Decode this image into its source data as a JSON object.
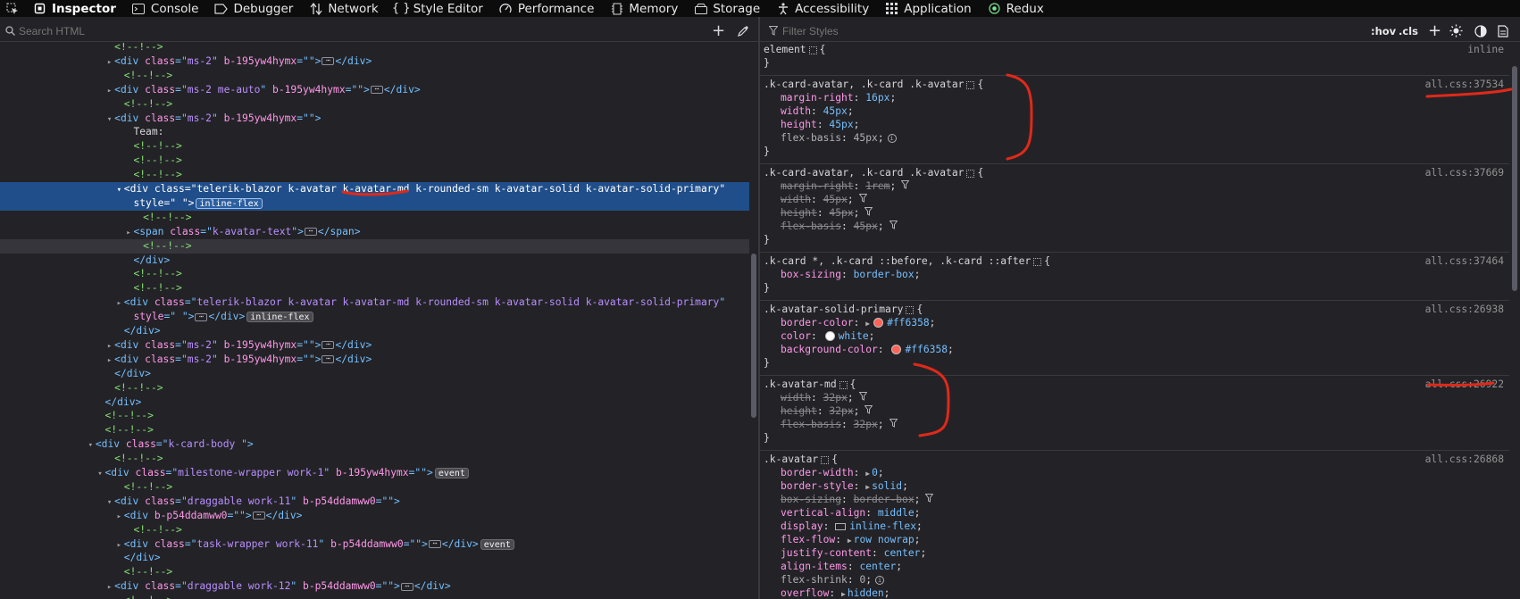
{
  "tabs": [
    {
      "label": "Inspector",
      "icon": "inspector-icon",
      "selected": true
    },
    {
      "label": "Console",
      "icon": "console-icon"
    },
    {
      "label": "Debugger",
      "icon": "debugger-icon"
    },
    {
      "label": "Network",
      "icon": "network-icon"
    },
    {
      "label": "Style Editor",
      "icon": "style-editor-icon"
    },
    {
      "label": "Performance",
      "icon": "performance-icon"
    },
    {
      "label": "Memory",
      "icon": "memory-icon"
    },
    {
      "label": "Storage",
      "icon": "storage-icon"
    },
    {
      "label": "Accessibility",
      "icon": "accessibility-icon"
    },
    {
      "label": "Application",
      "icon": "application-icon"
    },
    {
      "label": "Redux",
      "icon": "redux-icon"
    }
  ],
  "search": {
    "placeholder": "Search HTML",
    "add": "+"
  },
  "filter": {
    "placeholder": "Filter Styles",
    "hov": ":hov",
    "cls": ".cls",
    "add": "+"
  },
  "markup": [
    {
      "d": 11,
      "t": "",
      "s": [
        [
          "cm",
          "<!--!-->"
        ]
      ]
    },
    {
      "d": 11,
      "t": "c",
      "s": [
        [
          "tag",
          "<div "
        ],
        [
          "an",
          "class"
        ],
        [
          "tag",
          "=\""
        ],
        [
          "av",
          "ms-2"
        ],
        [
          "tag",
          "\" "
        ],
        [
          "an",
          "b-195yw4hymx"
        ],
        [
          "tag",
          "=\"\">"
        ],
        [
          "E",
          ""
        ],
        [
          "tag",
          "</div>"
        ]
      ]
    },
    {
      "d": 12,
      "t": "",
      "s": [
        [
          "cm",
          "<!--!-->"
        ]
      ]
    },
    {
      "d": 11,
      "t": "c",
      "s": [
        [
          "tag",
          "<div "
        ],
        [
          "an",
          "class"
        ],
        [
          "tag",
          "=\""
        ],
        [
          "av",
          "ms-2 me-auto"
        ],
        [
          "tag",
          "\" "
        ],
        [
          "an",
          "b-195yw4hymx"
        ],
        [
          "tag",
          "=\"\">"
        ],
        [
          "E",
          ""
        ],
        [
          "tag",
          "</div>"
        ]
      ]
    },
    {
      "d": 12,
      "t": "",
      "s": [
        [
          "cm",
          "<!--!-->"
        ]
      ]
    },
    {
      "d": 11,
      "t": "o",
      "s": [
        [
          "tag",
          "<div "
        ],
        [
          "an",
          "class"
        ],
        [
          "tag",
          "=\""
        ],
        [
          "av",
          "ms-2"
        ],
        [
          "tag",
          "\" "
        ],
        [
          "an",
          "b-195yw4hymx"
        ],
        [
          "tag",
          "=\"\">"
        ]
      ]
    },
    {
      "d": 13,
      "t": "",
      "s": [
        [
          "tx",
          "Team:"
        ]
      ]
    },
    {
      "d": 13,
      "t": "",
      "s": [
        [
          "cm",
          "<!--!-->"
        ]
      ]
    },
    {
      "d": 13,
      "t": "",
      "s": [
        [
          "cm",
          "<!--!-->"
        ]
      ]
    },
    {
      "d": 13,
      "t": "",
      "s": [
        [
          "cm",
          "<!--!-->"
        ]
      ]
    },
    {
      "d": 12,
      "t": "o",
      "sel": true,
      "s": [
        [
          "tag",
          "<div "
        ],
        [
          "an",
          "class"
        ],
        [
          "tag",
          "=\""
        ],
        [
          "av",
          "telerik-blazor k-avatar k-avatar-md k-rounded-sm k-avatar-solid k-avatar-solid-primary"
        ],
        [
          "tag",
          "\""
        ]
      ]
    },
    {
      "d": 13,
      "t": "",
      "sel": true,
      "s": [
        [
          "an",
          "style"
        ],
        [
          "tag",
          "=\" \">"
        ],
        [
          "B",
          "inline-flex"
        ]
      ]
    },
    {
      "d": 14,
      "t": "",
      "s": [
        [
          "cm",
          "<!--!-->"
        ]
      ]
    },
    {
      "d": 13,
      "t": "c",
      "s": [
        [
          "tag",
          "<span "
        ],
        [
          "an",
          "class"
        ],
        [
          "tag",
          "=\""
        ],
        [
          "av",
          "k-avatar-text"
        ],
        [
          "tag",
          "\">"
        ],
        [
          "E",
          ""
        ],
        [
          "tag",
          "</span>"
        ]
      ]
    },
    {
      "d": 14,
      "t": "",
      "hov": true,
      "s": [
        [
          "cm",
          "<!--!-->"
        ]
      ]
    },
    {
      "d": 13,
      "t": "",
      "s": [
        [
          "tag",
          "</div>"
        ]
      ]
    },
    {
      "d": 13,
      "t": "",
      "s": [
        [
          "cm",
          "<!--!-->"
        ]
      ]
    },
    {
      "d": 13,
      "t": "",
      "s": [
        [
          "cm",
          "<!--!-->"
        ]
      ]
    },
    {
      "d": 12,
      "t": "c",
      "s": [
        [
          "tag",
          "<div "
        ],
        [
          "an",
          "class"
        ],
        [
          "tag",
          "=\""
        ],
        [
          "av",
          "telerik-blazor k-avatar k-avatar-md k-rounded-sm k-avatar-solid k-avatar-solid-primary"
        ],
        [
          "tag",
          "\""
        ]
      ]
    },
    {
      "d": 13,
      "t": "",
      "s": [
        [
          "an",
          "style"
        ],
        [
          "tag",
          "=\" \">"
        ],
        [
          "E",
          ""
        ],
        [
          "tag",
          "</div>"
        ],
        [
          "B",
          "inline-flex"
        ]
      ]
    },
    {
      "d": 12,
      "t": "",
      "s": [
        [
          "tag",
          "</div>"
        ]
      ]
    },
    {
      "d": 11,
      "t": "c",
      "s": [
        [
          "tag",
          "<div "
        ],
        [
          "an",
          "class"
        ],
        [
          "tag",
          "=\""
        ],
        [
          "av",
          "ms-2"
        ],
        [
          "tag",
          "\" "
        ],
        [
          "an",
          "b-195yw4hymx"
        ],
        [
          "tag",
          "=\"\">"
        ],
        [
          "E",
          ""
        ],
        [
          "tag",
          "</div>"
        ]
      ]
    },
    {
      "d": 11,
      "t": "c",
      "s": [
        [
          "tag",
          "<div "
        ],
        [
          "an",
          "class"
        ],
        [
          "tag",
          "=\""
        ],
        [
          "av",
          "ms-2"
        ],
        [
          "tag",
          "\" "
        ],
        [
          "an",
          "b-195yw4hymx"
        ],
        [
          "tag",
          "=\"\">"
        ],
        [
          "E",
          ""
        ],
        [
          "tag",
          "</div>"
        ]
      ]
    },
    {
      "d": 11,
      "t": "",
      "s": [
        [
          "tag",
          "</div>"
        ]
      ]
    },
    {
      "d": 11,
      "t": "",
      "s": [
        [
          "cm",
          "<!--!-->"
        ]
      ]
    },
    {
      "d": 10,
      "t": "",
      "s": [
        [
          "tag",
          "</div>"
        ]
      ]
    },
    {
      "d": 10,
      "t": "",
      "s": [
        [
          "cm",
          "<!--!-->"
        ]
      ]
    },
    {
      "d": 10,
      "t": "",
      "s": [
        [
          "cm",
          "<!--!-->"
        ]
      ]
    },
    {
      "d": 9,
      "t": "o",
      "s": [
        [
          "tag",
          "<div "
        ],
        [
          "an",
          "class"
        ],
        [
          "tag",
          "=\""
        ],
        [
          "av",
          "k-card-body "
        ],
        [
          "tag",
          "\">"
        ]
      ]
    },
    {
      "d": 11,
      "t": "",
      "s": [
        [
          "cm",
          "<!--!-->"
        ]
      ]
    },
    {
      "d": 10,
      "t": "o",
      "s": [
        [
          "tag",
          "<div "
        ],
        [
          "an",
          "class"
        ],
        [
          "tag",
          "=\""
        ],
        [
          "av",
          "milestone-wrapper work-1"
        ],
        [
          "tag",
          "\" "
        ],
        [
          "an",
          "b-195yw4hymx"
        ],
        [
          "tag",
          "=\"\">"
        ],
        [
          "B",
          "event"
        ]
      ]
    },
    {
      "d": 12,
      "t": "",
      "s": [
        [
          "cm",
          "<!--!-->"
        ]
      ]
    },
    {
      "d": 11,
      "t": "o",
      "s": [
        [
          "tag",
          "<div "
        ],
        [
          "an",
          "class"
        ],
        [
          "tag",
          "=\""
        ],
        [
          "av",
          "draggable work-11"
        ],
        [
          "tag",
          "\" "
        ],
        [
          "an",
          "b-p54ddamww0"
        ],
        [
          "tag",
          "=\"\">"
        ]
      ]
    },
    {
      "d": 12,
      "t": "c",
      "s": [
        [
          "tag",
          "<div "
        ],
        [
          "an",
          "b-p54ddamww0"
        ],
        [
          "tag",
          "=\"\">"
        ],
        [
          "E",
          ""
        ],
        [
          "tag",
          "</div>"
        ]
      ]
    },
    {
      "d": 13,
      "t": "",
      "s": [
        [
          "cm",
          "<!--!-->"
        ]
      ]
    },
    {
      "d": 12,
      "t": "c",
      "s": [
        [
          "tag",
          "<div "
        ],
        [
          "an",
          "class"
        ],
        [
          "tag",
          "=\""
        ],
        [
          "av",
          "task-wrapper work-11"
        ],
        [
          "tag",
          "\" "
        ],
        [
          "an",
          "b-p54ddamww0"
        ],
        [
          "tag",
          "=\"\">"
        ],
        [
          "E",
          ""
        ],
        [
          "tag",
          "</div>"
        ],
        [
          "B",
          "event"
        ]
      ]
    },
    {
      "d": 12,
      "t": "",
      "s": [
        [
          "tag",
          "</div>"
        ]
      ]
    },
    {
      "d": 12,
      "t": "",
      "s": [
        [
          "cm",
          "<!--!-->"
        ]
      ]
    },
    {
      "d": 11,
      "t": "c",
      "s": [
        [
          "tag",
          "<div "
        ],
        [
          "an",
          "class"
        ],
        [
          "tag",
          "=\""
        ],
        [
          "av",
          "draggable work-12"
        ],
        [
          "tag",
          "\" "
        ],
        [
          "an",
          "b-p54ddamww0"
        ],
        [
          "tag",
          "=\"\">"
        ],
        [
          "E",
          ""
        ],
        [
          "tag",
          "</div>"
        ]
      ]
    },
    {
      "d": 12,
      "t": "",
      "s": [
        [
          "cm",
          "<!--!-->"
        ]
      ]
    }
  ],
  "rules": [
    {
      "selector": "element",
      "src": "inline",
      "decls": []
    },
    {
      "selector": ".k-card-avatar, .k-card .k-avatar",
      "src": "all.css:37534",
      "decls": [
        {
          "p": "margin-right",
          "v": "16px"
        },
        {
          "p": "width",
          "v": "45px"
        },
        {
          "p": "height",
          "v": "45px"
        },
        {
          "p": "flex-basis",
          "v": "45px",
          "info": true,
          "muted": true
        }
      ]
    },
    {
      "selector": ".k-card-avatar, .k-card .k-avatar",
      "src": "all.css:37669",
      "decls": [
        {
          "p": "margin-right",
          "v": "1rem",
          "over": true
        },
        {
          "p": "width",
          "v": "45px",
          "over": true
        },
        {
          "p": "height",
          "v": "45px",
          "over": true
        },
        {
          "p": "flex-basis",
          "v": "45px",
          "over": true
        }
      ]
    },
    {
      "selector": ".k-card *, .k-card ::before, .k-card ::after",
      "src": "all.css:37464",
      "decls": [
        {
          "p": "box-sizing",
          "v": "border-box"
        }
      ]
    },
    {
      "selector": ".k-avatar-solid-primary",
      "src": "all.css:26938",
      "decls": [
        {
          "p": "border-color",
          "v": "#ff6358",
          "arrow": true,
          "swatch": "#ff6358"
        },
        {
          "p": "color",
          "v": "white",
          "swatch": "#ffffff"
        },
        {
          "p": "background-color",
          "v": "#ff6358",
          "swatch": "#ff6358"
        }
      ]
    },
    {
      "selector": ".k-avatar-md",
      "src": "all.css:26922",
      "decls": [
        {
          "p": "width",
          "v": "32px",
          "over": true
        },
        {
          "p": "height",
          "v": "32px",
          "over": true
        },
        {
          "p": "flex-basis",
          "v": "32px",
          "over": true
        }
      ]
    },
    {
      "selector": ".k-avatar",
      "src": "all.css:26868",
      "decls": [
        {
          "p": "border-width",
          "v": "0",
          "arrow": true
        },
        {
          "p": "border-style",
          "v": "solid",
          "arrow": true
        },
        {
          "p": "box-sizing",
          "v": "border-box",
          "over": true
        },
        {
          "p": "vertical-align",
          "v": "middle"
        },
        {
          "p": "display",
          "v": "inline-flex",
          "flexbadge": true
        },
        {
          "p": "flex-flow",
          "v": "row nowrap",
          "arrow": true
        },
        {
          "p": "justify-content",
          "v": "center"
        },
        {
          "p": "align-items",
          "v": "center"
        },
        {
          "p": "flex-shrink",
          "v": "0",
          "info": true,
          "muted": true
        },
        {
          "p": "overflow",
          "v": "hidden",
          "arrow": true
        }
      ]
    }
  ],
  "colors": {
    "accent": "#204e8a",
    "annotation": "#e0291a"
  }
}
